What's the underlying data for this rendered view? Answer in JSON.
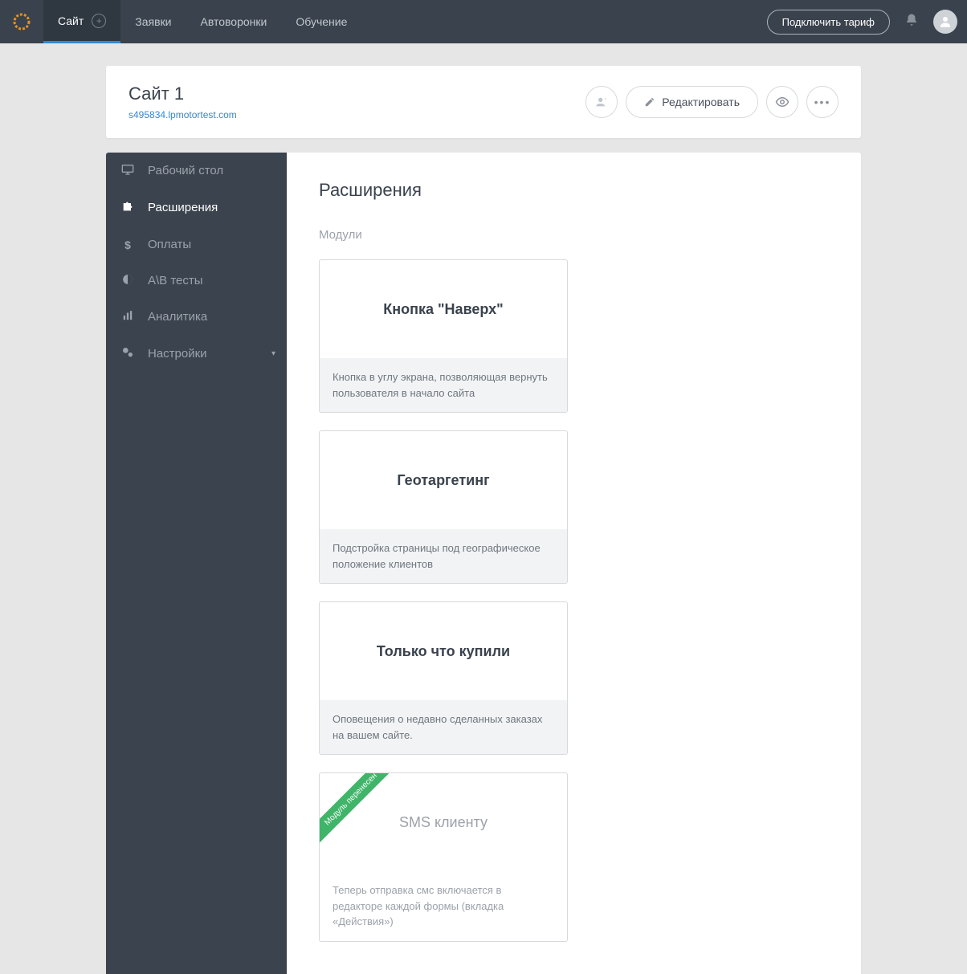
{
  "topnav": {
    "tabs": [
      "Сайт",
      "Заявки",
      "Автоворонки",
      "Обучение"
    ],
    "connect": "Подключить тариф"
  },
  "site": {
    "title": "Сайт 1",
    "url": "s495834.lpmotortest.com",
    "edit": "Редактировать"
  },
  "sidebar": {
    "items": [
      {
        "label": "Рабочий стол"
      },
      {
        "label": "Расширения"
      },
      {
        "label": "Оплаты"
      },
      {
        "label": "A\\B тесты"
      },
      {
        "label": "Аналитика"
      },
      {
        "label": "Настройки"
      }
    ]
  },
  "content": {
    "title": "Расширения",
    "section": "Модули",
    "cards": [
      {
        "title": "Кнопка \"Наверх\"",
        "desc": "Кнопка в углу экрана, позволяющая вернуть пользователя в начало сайта"
      },
      {
        "title": "Геотаргетинг",
        "desc": "Подстройка страницы под географическое положение клиентов"
      },
      {
        "title": "Только что купили",
        "desc": "Оповещения о недавно сделанных заказах на вашем сайте."
      },
      {
        "title": "SMS клиенту",
        "desc": "Теперь отправка смс включается в редакторе каждой формы (вкладка «Действия»)",
        "ribbon": "Модуль перенесен"
      }
    ]
  }
}
